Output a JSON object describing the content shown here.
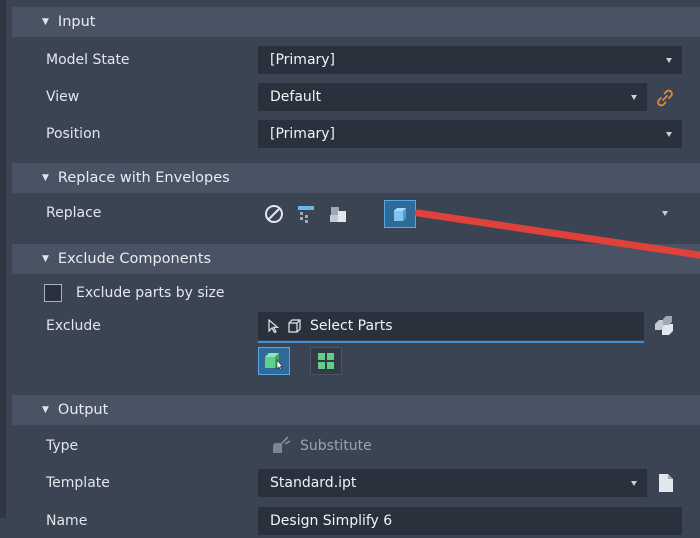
{
  "input": {
    "header": "Input",
    "model_state": {
      "label": "Model State",
      "value": "[Primary]"
    },
    "view": {
      "label": "View",
      "value": "Default"
    },
    "position": {
      "label": "Position",
      "value": "[Primary]"
    }
  },
  "replace_section": {
    "header": "Replace with Envelopes",
    "replace": {
      "label": "Replace"
    }
  },
  "exclude_section": {
    "header": "Exclude Components",
    "exclude_by_size": {
      "label": "Exclude parts by size",
      "checked": false
    },
    "exclude": {
      "label": "Exclude",
      "placeholder": "Select Parts"
    }
  },
  "output": {
    "header": "Output",
    "type": {
      "label": "Type",
      "value": "Substitute"
    },
    "template": {
      "label": "Template",
      "value": "Standard.ipt"
    },
    "name": {
      "label": "Name",
      "value": "Design Simplify 6"
    }
  },
  "colors": {
    "panel_bg": "#3b4453",
    "header_bg": "#4a5364",
    "field_bg": "#2b313c",
    "accent": "#3e8fd6",
    "annotation_arrow": "#e0423b"
  }
}
